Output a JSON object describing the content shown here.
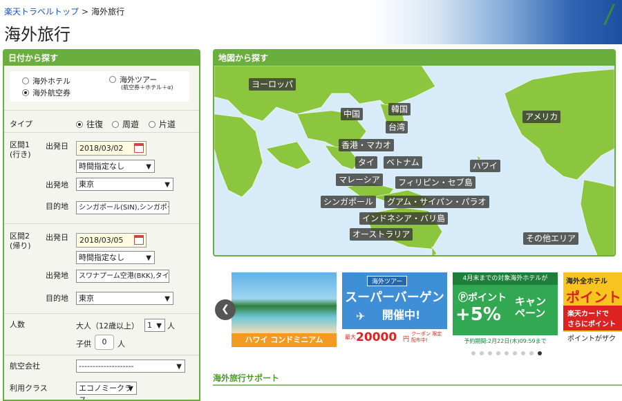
{
  "header": {
    "breadcrumb_home": "楽天トラベルトップ",
    "breadcrumb_sep": ">",
    "breadcrumb_current": "海外旅行",
    "page_title": "海外旅行"
  },
  "search": {
    "title": "日付から探す",
    "modes": {
      "hotel": "海外ホテル",
      "air": "海外航空券",
      "tour": "海外ツアー",
      "tour_sub": "(航空券＋ホテル＋α)"
    },
    "type_label": "タイプ",
    "type_options": [
      "往復",
      "周遊",
      "片道"
    ],
    "leg1": {
      "label_line1": "区間1",
      "label_line2": "(行き)",
      "date_label": "出発日",
      "date": "2018/03/02",
      "time": "時間指定なし",
      "from_label": "出発地",
      "from": "東京",
      "to_label": "目的地",
      "to": "シンガポール(SIN),シンガポー"
    },
    "leg2": {
      "label_line1": "区間2",
      "label_line2": "(帰り)",
      "date_label": "出発日",
      "date": "2018/03/05",
      "time": "時間指定なし",
      "from_label": "出発地",
      "from": "スワナプーム空港(BKK),タイ",
      "to_label": "目的地",
      "to": "東京"
    },
    "people_label": "人数",
    "adults_label": "大人（12歳以上）",
    "adults_value": "1",
    "person_unit": "人",
    "children_label": "子供",
    "children_value": "0",
    "airline_label": "航空会社",
    "airline_value": "--------------------",
    "class_label": "利用クラス",
    "class_value": "エコノミークラス"
  },
  "map": {
    "title": "地図から探す",
    "regions": [
      "ヨーロッパ",
      "中国",
      "韓国",
      "台湾",
      "香港・マカオ",
      "タイ",
      "ベトナム",
      "マレーシア",
      "フィリピン・セブ島",
      "ハワイ",
      "アメリカ",
      "シンガポール",
      "グアム・サイパン・パラオ",
      "インドネシア・バリ島",
      "オーストラリア",
      "その他エリア"
    ]
  },
  "banners": {
    "b1": {
      "caption": "ハワイ コンドミニアム"
    },
    "b2": {
      "tag": "海外ツアー",
      "headline": "スーパーバーゲン",
      "sub": "開催中!",
      "coupon_prefix": "最大",
      "coupon_amount": "20000",
      "coupon_unit": "円",
      "coupon_note": "クーポン 限定配布中!"
    },
    "b3": {
      "top": "4月末までの対象海外ホテルが",
      "point": "ポイント",
      "percent": "+5%",
      "campaign": "キャンペーン",
      "period": "予約期間:2月22日(木)09:59まで"
    },
    "b4": {
      "top": "海外全ホテル",
      "headline": "ポイント",
      "line2": "楽天カードで",
      "line3": "さらにポイント",
      "bottom": "ポイントがザク"
    }
  },
  "carousel": {
    "dot_count": 9,
    "active_index": 8
  },
  "support": {
    "title": "海外旅行サポート"
  },
  "colors": {
    "green": "#6aae3e",
    "link": "#1a55b5",
    "ocean": "#d7ecf8",
    "land": "#8cc63f"
  }
}
